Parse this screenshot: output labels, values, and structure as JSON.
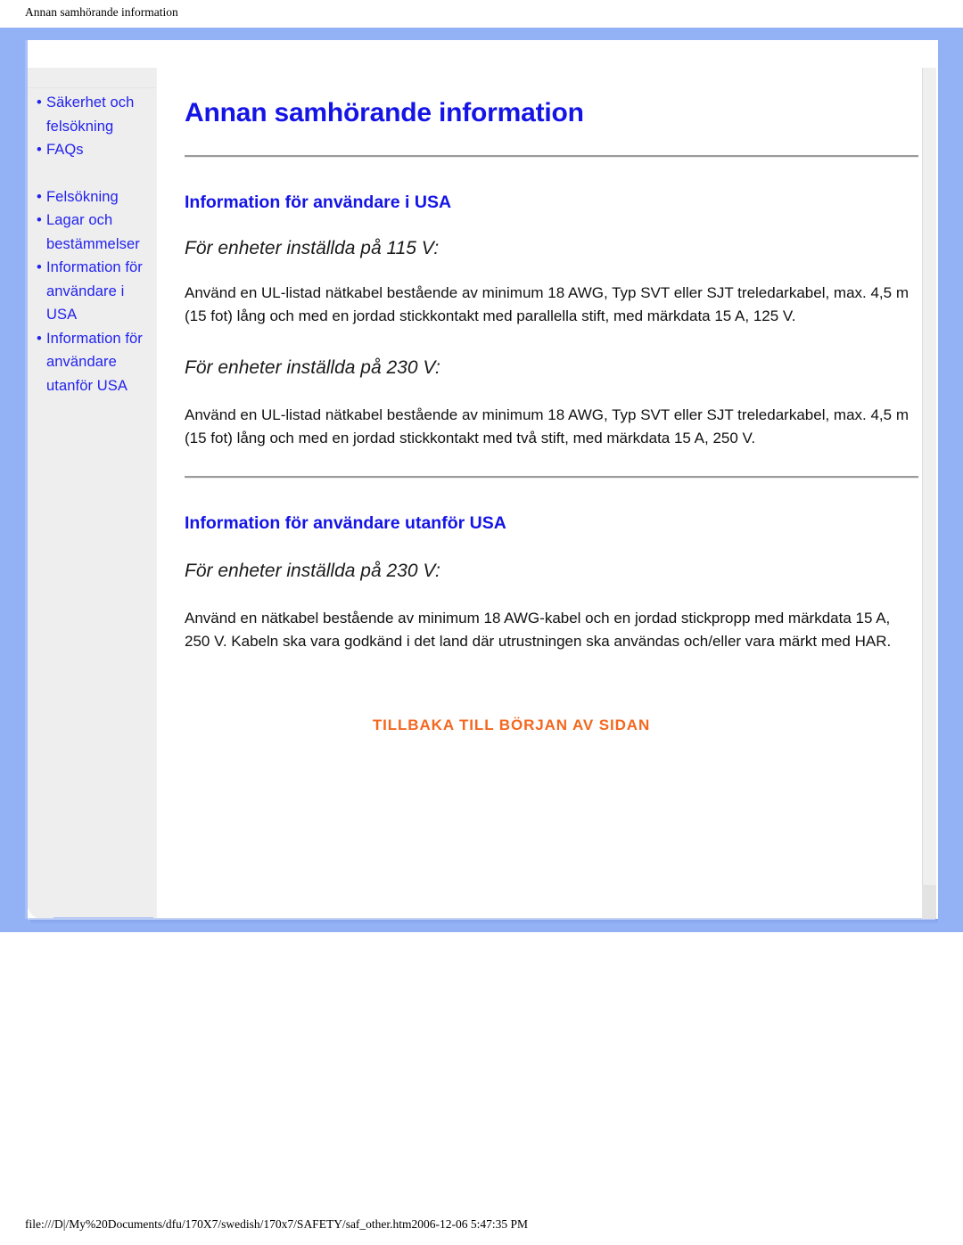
{
  "browser": {
    "header_title": "Annan samhörande information",
    "footer_url": "file:///D|/My%20Documents/dfu/170X7/swedish/170x7/SAFETY/saf_other.htm2006-12-06 5:47:35 PM"
  },
  "colors": {
    "frame_blue": "#93b1f5",
    "link_blue": "#2222ee",
    "heading_blue": "#1414e6",
    "backtop_orange": "#f4671f",
    "sidebar_gray": "#eeeeee"
  },
  "sidebar": {
    "items": [
      {
        "label": "Säkerhet och felsökning",
        "bullet": "•"
      },
      {
        "label": "FAQs",
        "bullet": "•"
      },
      {
        "label": "Felsökning",
        "bullet": "•"
      },
      {
        "label": "Lagar och bestämmelser",
        "bullet": "•"
      },
      {
        "label": "Information för användare i USA",
        "bullet": "•"
      },
      {
        "label": "Information för användare utanför USA",
        "bullet": "•"
      }
    ]
  },
  "main": {
    "title": "Annan samhörande information",
    "sections": [
      {
        "heading": "Information för användare i USA",
        "blocks": [
          {
            "subhead": "För enheter inställda på 115 V:",
            "body": "Använd en UL-listad nätkabel bestående av minimum 18 AWG, Typ SVT eller SJT treledarkabel, max. 4,5 m (15 fot) lång och med en jordad stickkontakt med parallella stift, med märkdata 15 A, 125 V."
          },
          {
            "subhead": "För enheter inställda på 230 V:",
            "body": "Använd en UL-listad nätkabel bestående av minimum 18 AWG, Typ SVT eller SJT treledarkabel, max. 4,5 m (15 fot) lång och med en jordad stickkontakt med två stift, med märkdata 15 A, 250 V."
          }
        ]
      },
      {
        "heading": "Information för användare utanför USA",
        "blocks": [
          {
            "subhead": "För enheter inställda på 230 V:",
            "body": "Använd en nätkabel bestående av minimum 18 AWG-kabel och en jordad stickpropp med märkdata 15 A, 250 V. Kabeln ska vara godkänd i det land där utrustningen ska användas och/eller vara märkt med HAR."
          }
        ]
      }
    ],
    "back_to_top": "TILLBAKA TILL BÖRJAN AV SIDAN"
  }
}
